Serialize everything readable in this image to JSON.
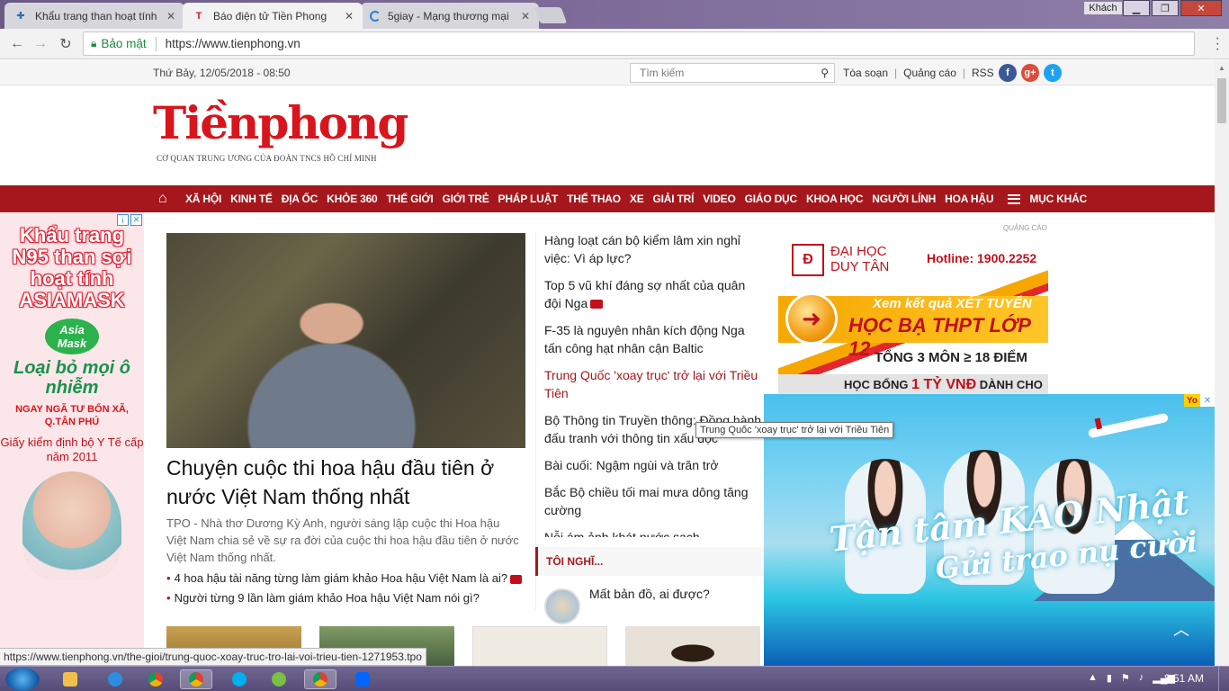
{
  "browser": {
    "tabs": [
      {
        "title": "Khẩu trang than hoạt tính",
        "active": false
      },
      {
        "title": "Báo điện tử Tiền Phong",
        "active": true
      },
      {
        "title": "5giay - Mạng thương mại",
        "active": false
      }
    ],
    "profile": "Khách",
    "secure_label": "Bảo mật",
    "url": "https://www.tienphong.vn",
    "status_url": "https://www.tienphong.vn/the-gioi/trung-quoc-xoay-truc-tro-lai-voi-trieu-tien-1271953.tpo"
  },
  "topbar": {
    "date": "Thứ Bảy, 12/05/2018 - 08:50",
    "search_placeholder": "Tìm kiếm",
    "links": [
      "Tòa soạn",
      "Quảng cáo",
      "RSS"
    ]
  },
  "logo": {
    "name": "Tiềnphong",
    "tagline": "CƠ QUAN TRUNG ƯƠNG CỦA ĐOÀN TNCS HỒ CHÍ MINH"
  },
  "nav": {
    "items": [
      "XÃ HỘI",
      "KINH TẾ",
      "ĐỊA ỐC",
      "KHỎE 360",
      "THẾ GIỚI",
      "GIỚI TRẺ",
      "PHÁP LUẬT",
      "THẾ THAO",
      "XE",
      "GIẢI TRÍ",
      "VIDEO",
      "GIÁO DỤC",
      "KHOA HỌC",
      "NGƯỜI LÍNH",
      "HOA HẬU"
    ],
    "more": "MỤC KHÁC"
  },
  "left_ad": {
    "headline": "Khẩu trang N95 than sợi hoạt tính ASIAMASK",
    "brand": "Asia Mask",
    "slogan": "Loại bỏ mọi ô nhiễm",
    "location": "NGAY NGÃ TƯ BỐN XÃ, Q.TÂN PHÚ",
    "cert": "Giấy kiểm định bộ Y Tế cấp năm 2011"
  },
  "hero": {
    "title": "Chuyện cuộc thi hoa hậu đầu tiên ở nước Việt Nam thống nhất",
    "sapo": "TPO - Nhà thơ Dương Kỳ Anh, người sáng lập cuộc thi Hoa hậu Việt Nam chia sẻ về sự ra đời của cuộc thi hoa hậu đầu tiên ở nước Việt Nam thống nhất.",
    "related": [
      "4 hoa hậu tài năng từng làm giám khảo Hoa hậu Việt Nam là ai?",
      "Người từng 9 lần làm giám khảo Hoa hậu Việt Nam nói gì?"
    ]
  },
  "middle": {
    "items": [
      {
        "title": "Hàng loạt cán bộ kiểm lâm xin nghỉ việc: Vì áp lực?",
        "video": false,
        "hover": false
      },
      {
        "title": "Top 5 vũ khí đáng sợ nhất của quân đội Nga",
        "video": true,
        "hover": false
      },
      {
        "title": "F-35 là nguyên nhân kích động Nga tấn công hạt nhân cận Baltic",
        "video": false,
        "hover": false
      },
      {
        "title": "Trung Quốc 'xoay trục' trở lại với Triều Tiên",
        "video": false,
        "hover": true
      },
      {
        "title": "Bộ Thông tin Truyền thông: Đồng hành đấu tranh với thông tin xấu độc",
        "video": false,
        "hover": false
      },
      {
        "title": "Bài cuối: Ngậm ngùi và trăn trở",
        "video": false,
        "hover": false
      },
      {
        "title": "Bắc Bộ chiều tối mai mưa dông tăng cường",
        "video": false,
        "hover": false
      },
      {
        "title": "Nỗi ám ảnh khát nước sạch",
        "video": false,
        "hover": false
      }
    ],
    "section": "TÔI NGHĨ...",
    "opinion_title": "Mất bản đồ, ai được?",
    "tooltip": "Trung Quốc 'xoay trục' trở lại với Triều Tiên"
  },
  "right_ad": {
    "label": "QUẢNG CÁO",
    "school": "ĐẠI HỌC DUY TÂN",
    "hotline": "Hotline: 1900.2252",
    "line1": "Xem kết quả XÉT TUYỂN",
    "line2": "HỌC BẠ THPT LỚP 12",
    "line3": "TỔNG 3 MÔN ≥ 18 ĐIỂM",
    "scholarship_pre": "HỌC BỔNG",
    "scholarship_amt": "1 TỶ VNĐ",
    "scholarship_post": "DÀNH CHO"
  },
  "float_ad": {
    "slogan1": "Tận tâm KAO Nhật",
    "slogan2": "Gửi trao nụ cười",
    "badge": "Yo"
  },
  "taskbar": {
    "time": "8:51 AM"
  },
  "colors": {
    "brand_red": "#a5171c",
    "logo_red": "#d8151c"
  }
}
